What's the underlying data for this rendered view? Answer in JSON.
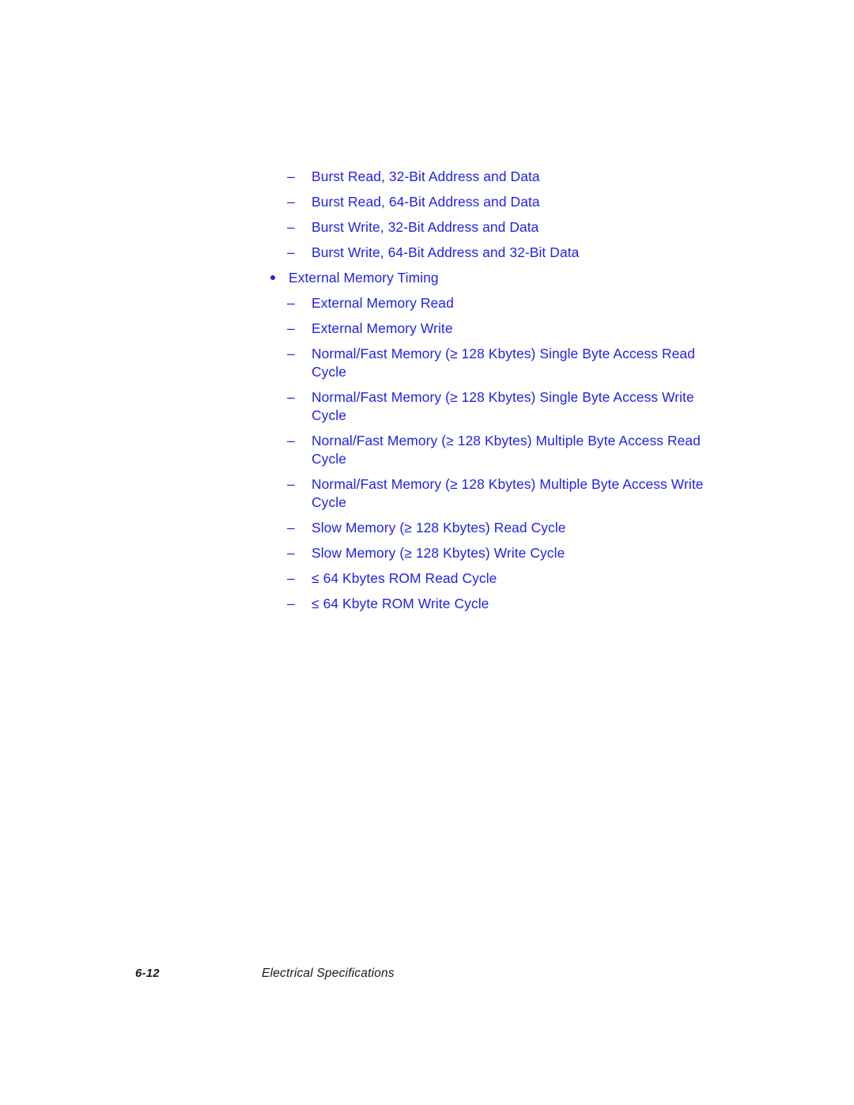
{
  "page": {
    "background_color": "#ffffff",
    "text_color": "#2222e8",
    "footer_text_color": "#1a1a1a"
  },
  "content": {
    "items": [
      {
        "level": 2,
        "marker": "en-dash",
        "text": "Burst Read, 32-Bit Address and Data"
      },
      {
        "level": 2,
        "marker": "en-dash",
        "text": "Burst Read, 64-Bit Address and Data"
      },
      {
        "level": 2,
        "marker": "en-dash",
        "text": "Burst Write, 32-Bit Address and Data"
      },
      {
        "level": 2,
        "marker": "en-dash",
        "text": "Burst Write, 64-Bit Address and 32-Bit Data"
      },
      {
        "level": 1,
        "marker": "bullet",
        "text": "External Memory Timing"
      },
      {
        "level": 2,
        "marker": "en-dash",
        "text": "External Memory Read"
      },
      {
        "level": 2,
        "marker": "en-dash",
        "text": "External Memory Write"
      },
      {
        "level": 2,
        "marker": "en-dash",
        "text": "Normal/Fast Memory (≥ 128 Kbytes) Single Byte Access Read Cycle"
      },
      {
        "level": 2,
        "marker": "en-dash",
        "text": "Normal/Fast Memory (≥ 128 Kbytes) Single Byte Access Write Cycle"
      },
      {
        "level": 2,
        "marker": "en-dash",
        "text": "Nornal/Fast Memory (≥ 128 Kbytes) Multiple Byte Access Read Cycle"
      },
      {
        "level": 2,
        "marker": "en-dash",
        "text": "Normal/Fast Memory (≥ 128 Kbytes) Multiple Byte Access Write Cycle"
      },
      {
        "level": 2,
        "marker": "en-dash",
        "text": "Slow Memory (≥ 128 Kbytes) Read Cycle"
      },
      {
        "level": 2,
        "marker": "en-dash",
        "text": "Slow Memory (≥ 128 Kbytes) Write Cycle"
      },
      {
        "level": 2,
        "marker": "en-dash",
        "text": "≤ 64 Kbytes ROM Read Cycle"
      },
      {
        "level": 2,
        "marker": "en-dash",
        "text": "≤ 64 Kbyte ROM Write Cycle"
      }
    ],
    "dash_glyph": "–"
  },
  "footer": {
    "page_number": "6-12",
    "chapter_title": "Electrical Specifications"
  }
}
